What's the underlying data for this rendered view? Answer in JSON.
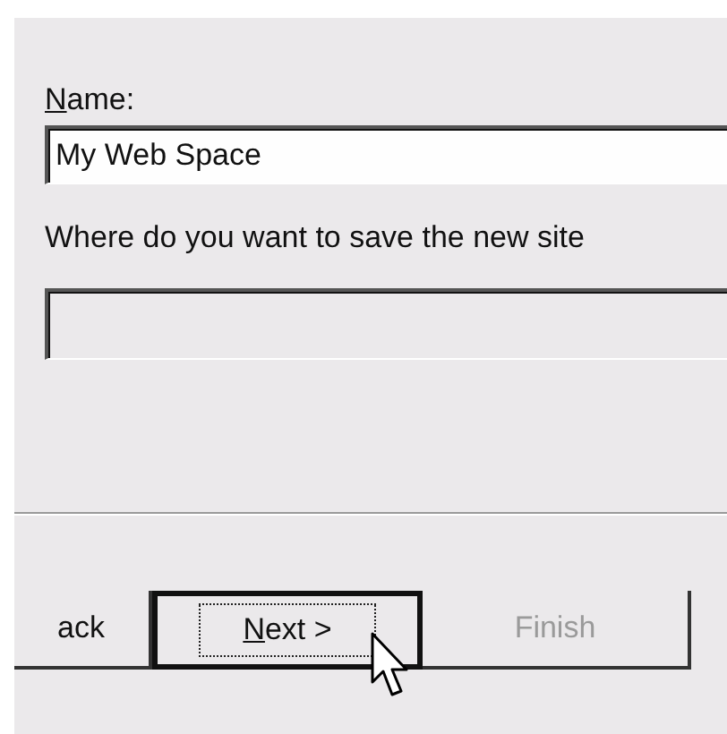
{
  "name_field": {
    "label": "Name:",
    "value": "My Web Space",
    "disabled": false
  },
  "location_field": {
    "label": "Where do you want to save the new site",
    "disabled": true
  },
  "buttons": [
    {
      "label": "ack",
      "kind": "back",
      "disabled": false,
      "focused": false
    },
    {
      "label": "Next >",
      "kind": "next",
      "disabled": false,
      "focused": true
    },
    {
      "label": "Finish",
      "kind": "finish",
      "disabled": true,
      "focused": false
    }
  ]
}
